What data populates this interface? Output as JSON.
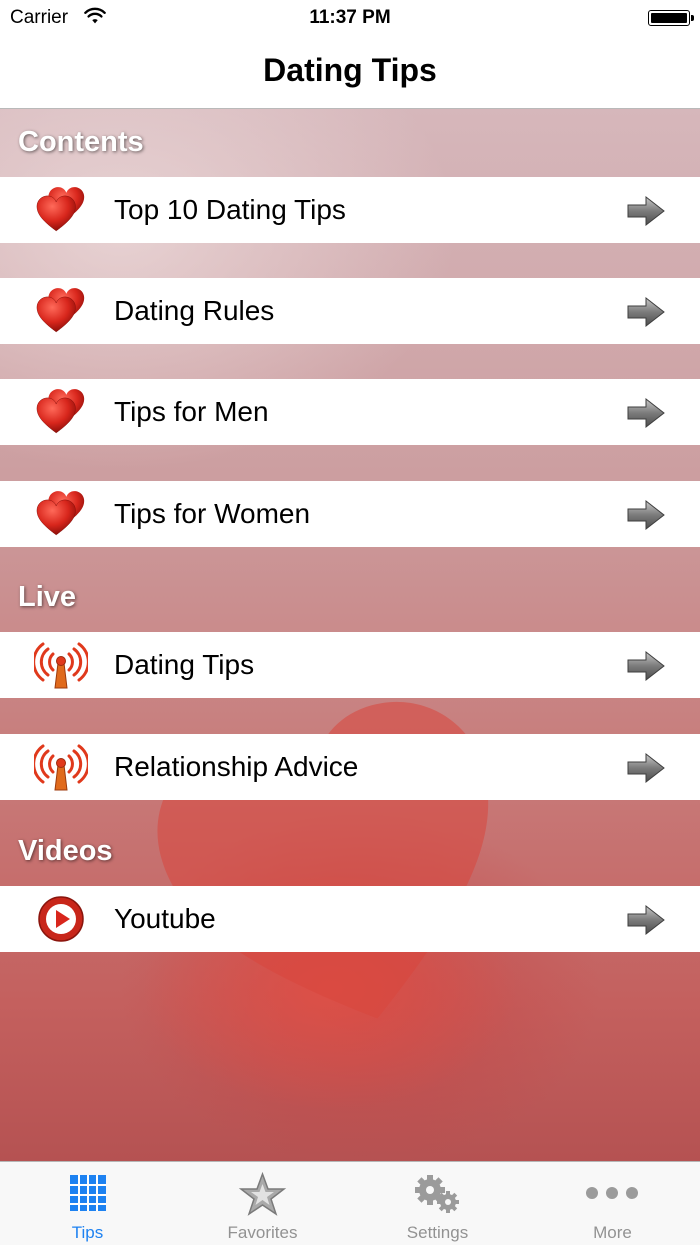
{
  "status_bar": {
    "carrier": "Carrier",
    "time": "11:37 PM"
  },
  "nav": {
    "title": "Dating Tips"
  },
  "sections": [
    {
      "title": "Contents",
      "rows": [
        {
          "label": "Top 10 Dating Tips",
          "icon": "hearts-icon"
        },
        {
          "label": "Dating Rules",
          "icon": "hearts-icon"
        },
        {
          "label": "Tips for Men",
          "icon": "hearts-icon"
        },
        {
          "label": "Tips for Women",
          "icon": "hearts-icon"
        }
      ]
    },
    {
      "title": "Live",
      "rows": [
        {
          "label": "Dating Tips",
          "icon": "radio-tower-icon"
        },
        {
          "label": "Relationship Advice",
          "icon": "radio-tower-icon"
        }
      ]
    },
    {
      "title": "Videos",
      "rows": [
        {
          "label": "Youtube",
          "icon": "play-icon"
        }
      ]
    }
  ],
  "tabs": [
    {
      "label": "Tips",
      "icon": "tips-icon",
      "active": true
    },
    {
      "label": "Favorites",
      "icon": "star-icon",
      "active": false
    },
    {
      "label": "Settings",
      "icon": "gears-icon",
      "active": false
    },
    {
      "label": "More",
      "icon": "more-dots-icon",
      "active": false
    }
  ],
  "colors": {
    "accent": "#1e82f1",
    "tab_inactive": "#929292",
    "heart_red": "#d8261c"
  }
}
